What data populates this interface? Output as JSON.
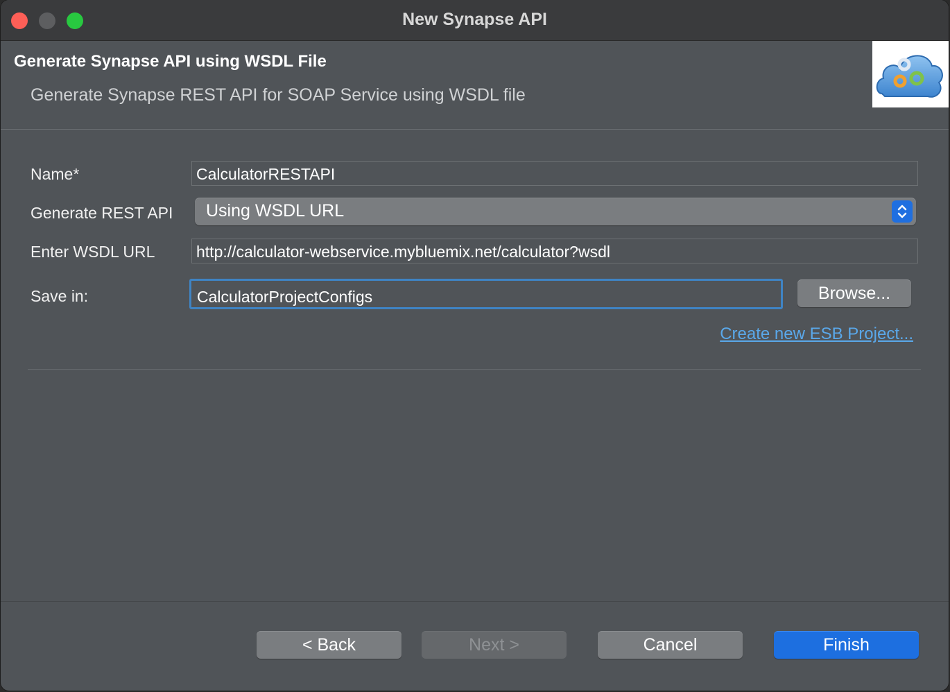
{
  "window": {
    "title": "New Synapse API"
  },
  "header": {
    "title": "Generate Synapse API using WSDL File",
    "subtitle": "Generate Synapse REST API for SOAP Service using WSDL file",
    "banner_icon": "gears-cloud-icon"
  },
  "form": {
    "name_label": "Name*",
    "name_value": "CalculatorRESTAPI",
    "generate_label": "Generate REST API",
    "generate_value": "Using WSDL URL",
    "wsdl_label": "Enter WSDL URL",
    "wsdl_value": "http://calculator-webservice.mybluemix.net/calculator?wsdl",
    "save_label": "Save in:",
    "save_value": "CalculatorProjectConfigs",
    "browse_label": "Browse...",
    "create_project_link": "Create new ESB Project..."
  },
  "buttons": {
    "back": "< Back",
    "next": "Next >",
    "cancel": "Cancel",
    "finish": "Finish"
  },
  "colors": {
    "accent": "#1d6fe0",
    "link": "#5aa8ea",
    "focus_ring": "#3f84c4",
    "close": "#fe5f57",
    "maximize": "#28c840"
  }
}
